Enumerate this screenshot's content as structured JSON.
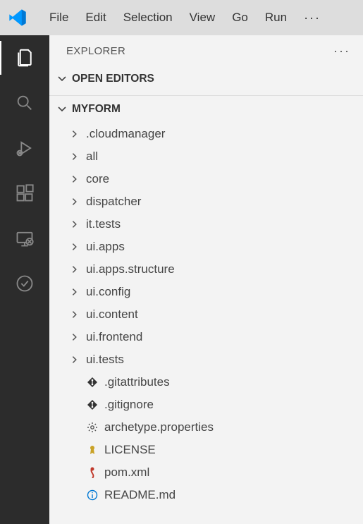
{
  "menubar": {
    "items": [
      "File",
      "Edit",
      "Selection",
      "View",
      "Go",
      "Run"
    ],
    "more": "···"
  },
  "sidebar": {
    "title": "EXPLORER",
    "more": "···"
  },
  "sections": {
    "openEditors": "OPEN EDITORS",
    "workspace": "MYFORM"
  },
  "tree": {
    "folders": [
      ".cloudmanager",
      "all",
      "core",
      "dispatcher",
      "it.tests",
      "ui.apps",
      "ui.apps.structure",
      "ui.config",
      "ui.content",
      "ui.frontend",
      "ui.tests"
    ],
    "files": [
      {
        "name": ".gitattributes",
        "icon": "git"
      },
      {
        "name": ".gitignore",
        "icon": "git"
      },
      {
        "name": "archetype.properties",
        "icon": "gear"
      },
      {
        "name": "LICENSE",
        "icon": "license"
      },
      {
        "name": "pom.xml",
        "icon": "xml"
      },
      {
        "name": "README.md",
        "icon": "info"
      }
    ]
  }
}
